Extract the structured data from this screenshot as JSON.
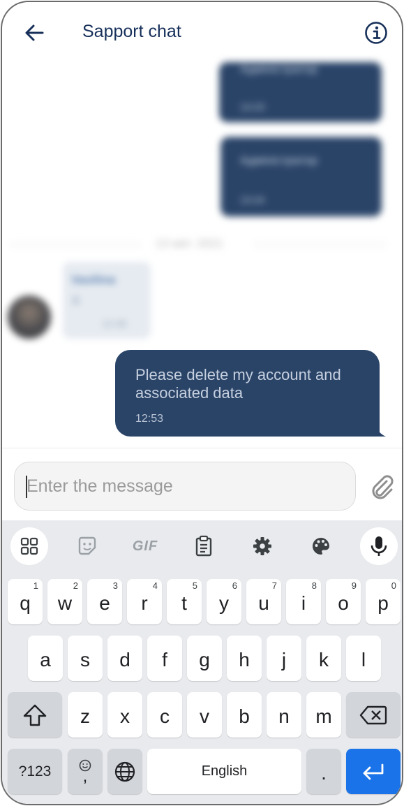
{
  "header": {
    "title": "Sapport chat",
    "back_icon": "arrow-left-icon",
    "info_icon": "info-circle-icon"
  },
  "history": {
    "bubble1_text": "Адміністратор",
    "bubble1_time": "13:23",
    "bubble2_text": "Адміністратор",
    "bubble2_time": "13:24",
    "date_separator": "13 квіт. 2021",
    "incoming_name": "Vasilina",
    "incoming_text": "й",
    "incoming_time": "12:48"
  },
  "message": {
    "text": "Please delete my account and associated data",
    "time": "12:53"
  },
  "composer": {
    "placeholder": "Enter the message",
    "attach_icon": "paperclip-icon"
  },
  "keyboard": {
    "toolbar": [
      "grid-icon",
      "sticker-icon",
      "GIF",
      "clipboard-icon",
      "gear-icon",
      "palette-icon",
      "microphone-icon"
    ],
    "gif_label": "GIF",
    "row1": [
      {
        "k": "q",
        "n": "1"
      },
      {
        "k": "w",
        "n": "2"
      },
      {
        "k": "e",
        "n": "3"
      },
      {
        "k": "r",
        "n": "4"
      },
      {
        "k": "t",
        "n": "5"
      },
      {
        "k": "y",
        "n": "6"
      },
      {
        "k": "u",
        "n": "7"
      },
      {
        "k": "i",
        "n": "8"
      },
      {
        "k": "o",
        "n": "9"
      },
      {
        "k": "p",
        "n": "0"
      }
    ],
    "row2": [
      "a",
      "s",
      "d",
      "f",
      "g",
      "h",
      "j",
      "k",
      "l"
    ],
    "row3": [
      "z",
      "x",
      "c",
      "v",
      "b",
      "n",
      "m"
    ],
    "sym_label": "?123",
    "comma_label": ",",
    "space_label": "English",
    "period_label": ".",
    "accent_color": "#1a73e8"
  }
}
